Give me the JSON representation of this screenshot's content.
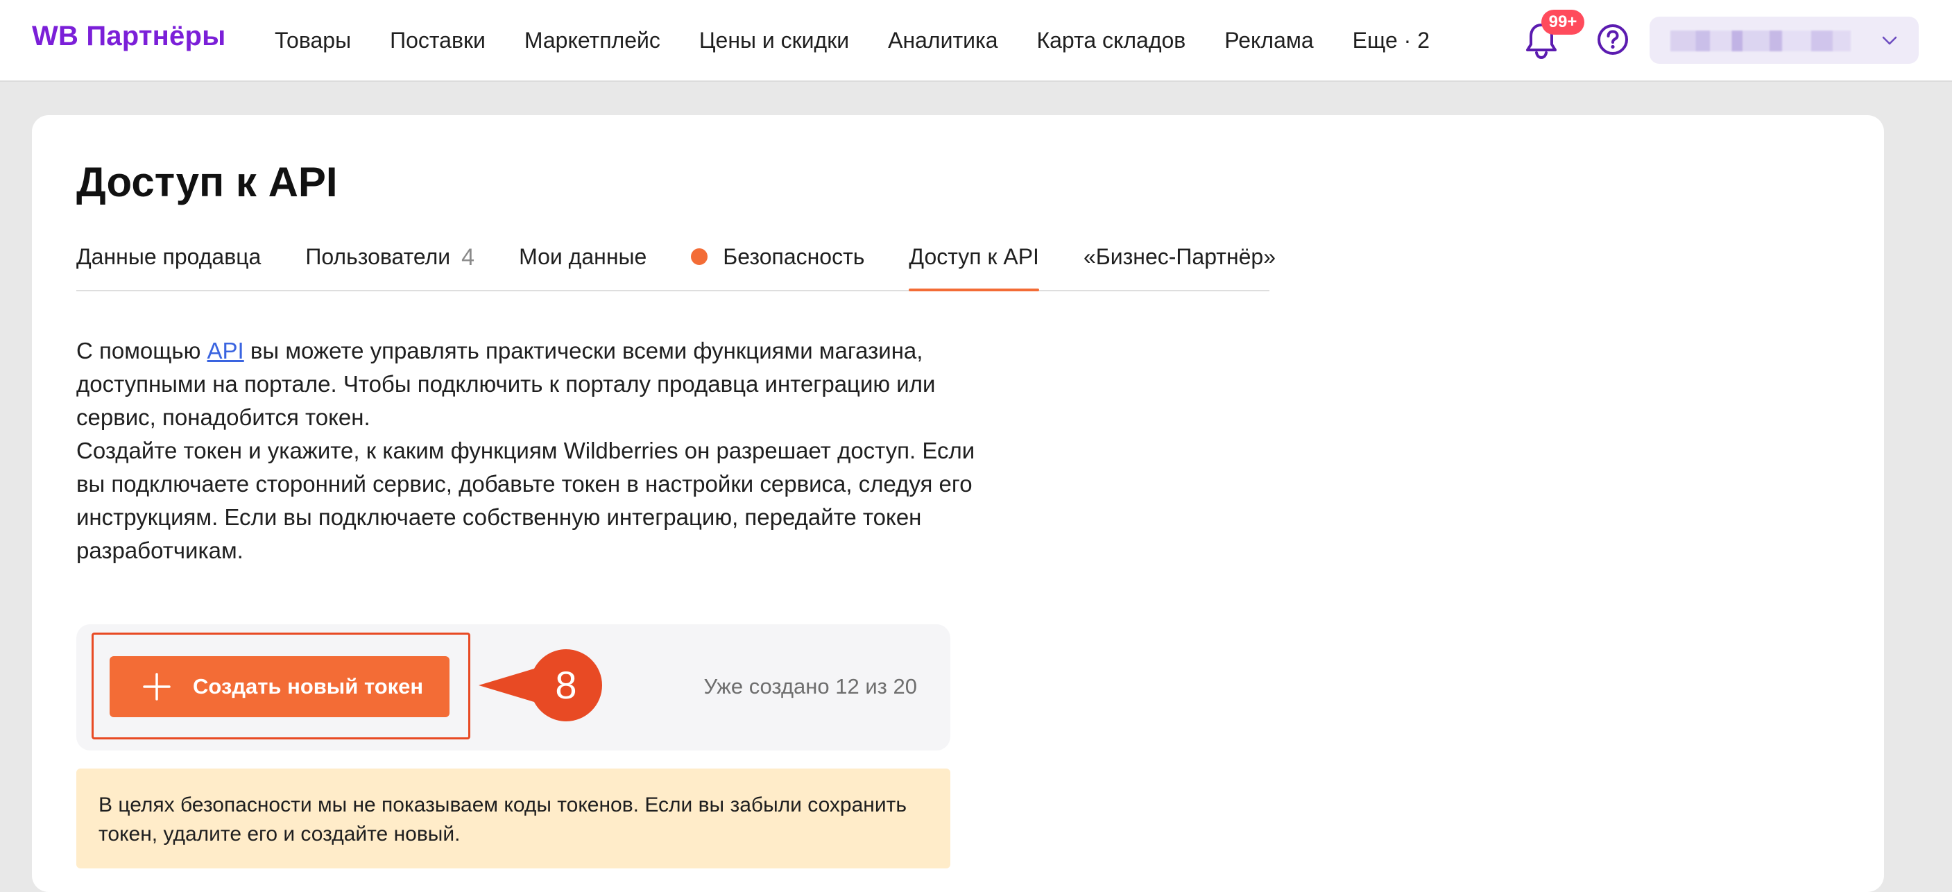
{
  "header": {
    "logo": "WB Партнёры",
    "nav": [
      "Товары",
      "Поставки",
      "Маркетплейс",
      "Цены и скидки",
      "Аналитика",
      "Карта складов",
      "Реклама",
      "Еще · 2"
    ],
    "notifications_badge": "99+",
    "icons": {
      "notifications": "bell-icon",
      "help": "question-circle-icon",
      "profile_dropdown": "chevron-down-icon"
    },
    "colors": {
      "logo": "#7b1fd8",
      "badge": "#ff4b5c",
      "profile_bg": "#efebf8"
    }
  },
  "page": {
    "title": "Доступ к API",
    "tabs": [
      {
        "label": "Данные продавца"
      },
      {
        "label": "Пользователи",
        "count": "4"
      },
      {
        "label": "Мои данные"
      },
      {
        "label": "Безопасность",
        "indicator": "orange-dot"
      },
      {
        "label": "Доступ к API",
        "active": true
      },
      {
        "label": "«Бизнес-Партнёр»"
      }
    ],
    "description": {
      "line1_before": "С помощью ",
      "link": "API",
      "line1_after": " вы можете управлять практически всеми функциями магазина, доступными на портале. Чтобы подключить к порталу продавца интеграцию или сервис, понадобится токен.",
      "paragraph2": "Создайте токен и укажите, к каким функциям Wildberries он разрешает доступ. Если вы подключаете сторонний сервис, добавьте токен в настройки сервиса, следуя его инструкциям. Если вы подключаете собственную интеграцию, передайте токен разработчикам."
    },
    "token_panel": {
      "create_button": "Создать новый токен",
      "step_marker": "8",
      "created_count": "Уже создано 12 из 20"
    },
    "notice": "В целях безопасности мы не показываем коды токенов. Если вы забыли сохранить токен, удалите его и создайте новый.",
    "colors": {
      "accent": "#f36c36",
      "highlight_frame": "#e84a24",
      "link": "#3a64e0",
      "notice_bg": "#ffecc9"
    }
  }
}
